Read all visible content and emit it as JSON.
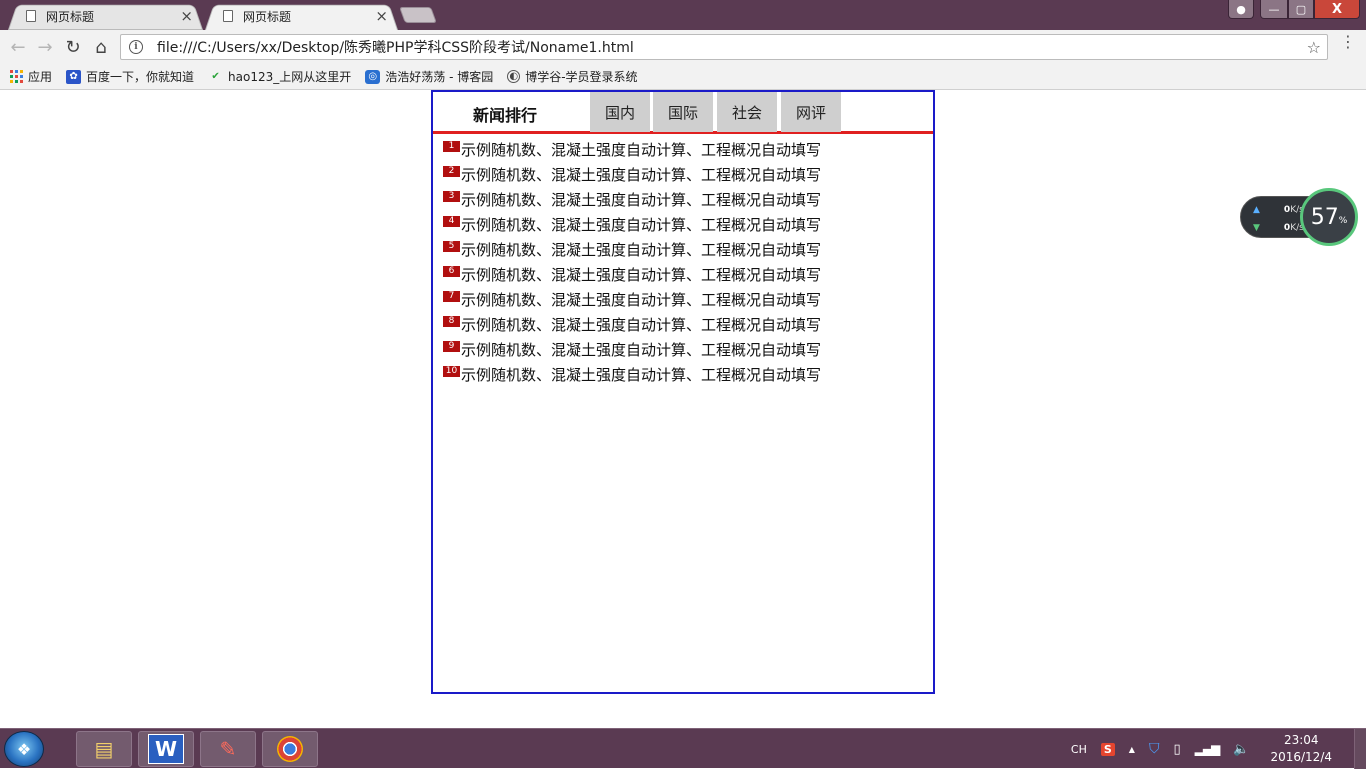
{
  "browser": {
    "tabs": [
      {
        "title": "网页标题",
        "close": "×",
        "active": false
      },
      {
        "title": "网页标题",
        "close": "×",
        "active": true
      }
    ],
    "window_controls": {
      "minimize": "—",
      "maximize": "▢",
      "close": "X"
    },
    "nav": {
      "back": "←",
      "forward": "→",
      "reload": "↻",
      "home": "⌂"
    },
    "address": {
      "info": "i",
      "url": "file:///C:/Users/xx/Desktop/陈秀曦PHP学科CSS阶段考试/Noname1.html",
      "star": "☆"
    },
    "menu": "⋮",
    "bookmarks": [
      {
        "label": "应用",
        "icon": "apps-grid-icon"
      },
      {
        "label": "百度一下，你就知道",
        "icon": "baidu-paw-icon"
      },
      {
        "label": "hao123_上网从这里开",
        "icon": "hao123-icon"
      },
      {
        "label": "浩浩好荡荡 - 博客园",
        "icon": "cnblogs-icon"
      },
      {
        "label": "博学谷-学员登录系统",
        "icon": "boxuegu-icon"
      }
    ]
  },
  "news": {
    "title": "新闻排行",
    "tabs": [
      "国内",
      "国际",
      "社会",
      "网评"
    ],
    "items": [
      {
        "num": "1",
        "text": "示例随机数、混凝土强度自动计算、工程概况自动填写"
      },
      {
        "num": "2",
        "text": "示例随机数、混凝土强度自动计算、工程概况自动填写"
      },
      {
        "num": "3",
        "text": "示例随机数、混凝土强度自动计算、工程概况自动填写"
      },
      {
        "num": "4",
        "text": "示例随机数、混凝土强度自动计算、工程概况自动填写"
      },
      {
        "num": "5",
        "text": "示例随机数、混凝土强度自动计算、工程概况自动填写"
      },
      {
        "num": "6",
        "text": "示例随机数、混凝土强度自动计算、工程概况自动填写"
      },
      {
        "num": "7",
        "text": "示例随机数、混凝土强度自动计算、工程概况自动填写"
      },
      {
        "num": "8",
        "text": "示例随机数、混凝土强度自动计算、工程概况自动填写"
      },
      {
        "num": "9",
        "text": "示例随机数、混凝土强度自动计算、工程概况自动填写"
      },
      {
        "num": "10",
        "text": "示例随机数、混凝土强度自动计算、工程概况自动填写"
      }
    ]
  },
  "speed_widget": {
    "upload": "0",
    "upload_unit": "K/s",
    "download": "0",
    "download_unit": "K/s",
    "percent": "57",
    "percent_unit": "%"
  },
  "taskbar": {
    "apps": [
      {
        "name": "file-explorer",
        "glyph": "▤"
      },
      {
        "name": "wps-writer",
        "glyph": "W"
      },
      {
        "name": "editor",
        "glyph": "✎"
      },
      {
        "name": "chrome",
        "glyph": "◉"
      }
    ],
    "tray": {
      "ime": "CH",
      "sogou": "S",
      "arrow": "▲",
      "time": "23:04",
      "date": "2016/12/4"
    }
  },
  "colors": {
    "titlebar": "#5a3a52",
    "news_border": "#1a1ac8",
    "news_underline": "#e02020",
    "rank_badge": "#b10f0f",
    "news_tab_bg": "#cfcfcf"
  }
}
